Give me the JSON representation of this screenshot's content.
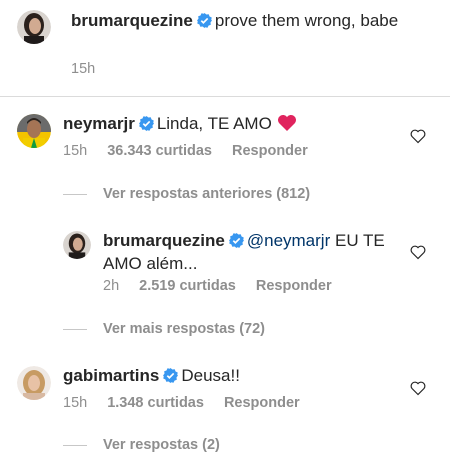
{
  "post": {
    "username": "brumarquezine",
    "text": "prove them wrong, babe",
    "time": "15h"
  },
  "comments": [
    {
      "username": "neymarjr",
      "text": "Linda, TE AMO",
      "emoji": "❤️",
      "time": "15h",
      "likes": "36.343 curtidas",
      "reply": "Responder",
      "view_replies": "Ver respostas anteriores (812)"
    },
    {
      "username": "brumarquezine",
      "mention": "@neymarjr",
      "text": "EU TE AMO além...",
      "time": "2h",
      "likes": "2.519 curtidas",
      "reply": "Responder",
      "view_replies": "Ver mais respostas (72)"
    },
    {
      "username": "gabimartins",
      "text": "Deusa!!",
      "time": "15h",
      "likes": "1.348 curtidas",
      "reply": "Responder",
      "view_replies": "Ver respostas (2)"
    }
  ],
  "colors": {
    "verified": "#3897f0",
    "text": "#262626",
    "meta": "#8e8e8e",
    "heart": "#e0245e"
  }
}
